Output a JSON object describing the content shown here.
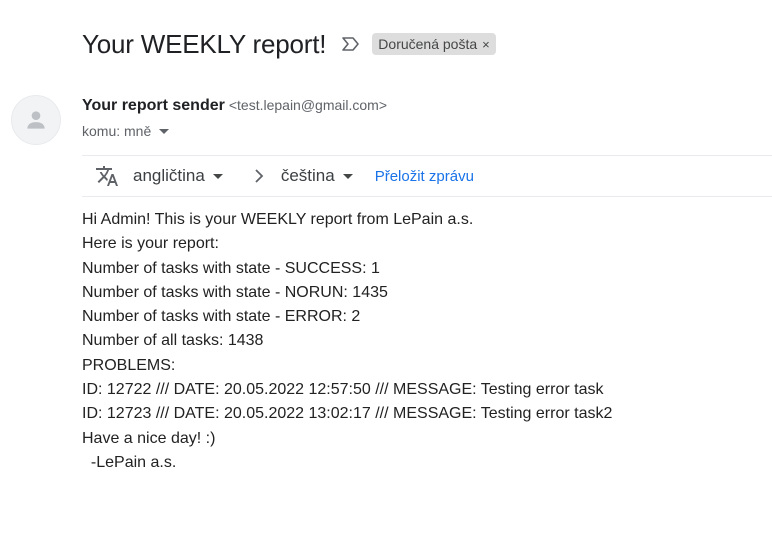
{
  "subject": {
    "title": "Your WEEKLY report!",
    "importance_icon": "importance-marker-icon",
    "label": "Doručená pošta",
    "label_remove": "×"
  },
  "sender": {
    "avatar_icon": "default-avatar-icon",
    "name": "Your report sender",
    "email": "<test.lepain@gmail.com>",
    "recipient_text": "komu: mně"
  },
  "translate_bar": {
    "icon": "translate-icon",
    "from_language": "angličtina",
    "arrow_icon": "chevron-right-icon",
    "to_language": "čeština",
    "action_label": "Přeložit zprávu"
  },
  "message": {
    "lines": [
      "Hi Admin! This is your WEEKLY report from LePain a.s.",
      "Here is your report:",
      "Number of tasks with state - SUCCESS: 1",
      "Number of tasks with state - NORUN: 1435",
      "Number of tasks with state - ERROR: 2",
      "Number of all tasks: 1438",
      "PROBLEMS:",
      "ID: 12722 /// DATE: 20.05.2022 12:57:50 /// MESSAGE: Testing error task",
      "ID: 12723 /// DATE: 20.05.2022 13:02:17 /// MESSAGE: Testing error task2",
      "Have a nice day! :)",
      "  -LePain a.s."
    ]
  },
  "colors": {
    "link": "#1a73e8",
    "label_chip_bg": "#dddddd",
    "secondary_text": "#5f6368"
  }
}
